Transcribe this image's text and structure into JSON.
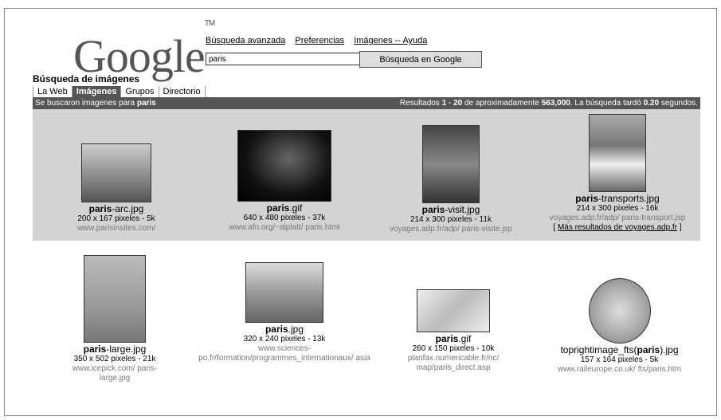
{
  "header": {
    "logo": "Google",
    "trademark": "TM",
    "subtitle": "Búsqueda de imágenes",
    "links": {
      "advanced": "Búsqueda avanzada",
      "prefs": "Preferencias",
      "images_help": "Imágenes -- Ayuda"
    },
    "search_value": "paris",
    "search_button": "Búsqueda en Google"
  },
  "tabs": [
    "La Web",
    "Imágenes",
    "Grupos",
    "Directorio"
  ],
  "results_bar": {
    "left_prefix": "Se buscaron imagenes para ",
    "query": "paris",
    "r_label": "Resultados ",
    "r_from": "1",
    "r_dash": " - ",
    "r_to": "20",
    "r_of": " de aproximadamente ",
    "r_total": "563,000",
    "r_took": ". La búsqueda tardó ",
    "r_time": "0.20",
    "r_sec": " segundos."
  },
  "results": [
    {
      "bold": "paris",
      "rest": "-arc.jpg",
      "size": "200 x 167 pixeles - 5k",
      "url": "www.parisinsites.com/"
    },
    {
      "bold": "paris",
      "rest": ".gif",
      "size": "640 x 480 pixeles - 37k",
      "url": "www.afn.org/~alplatt/ paris.html"
    },
    {
      "bold": "paris",
      "rest": "-visit.jpg",
      "size": "214 x 300 pixeles - 11k",
      "url": "voyages.adp.fr/adp/ paris-visite.jsp"
    },
    {
      "bold": "paris",
      "rest": "-transports.jpg",
      "size": "214 x 300 pixeles - 16k",
      "url": "voyages.adp.fr/adp/ paris-transport.jsp",
      "more": "Más resultados de voyages.adp.fr"
    },
    {
      "bold": "paris",
      "rest": "-large.jpg",
      "size": "350 x 502 pixeles - 21k",
      "url": "www.icepick.com/ paris-large.jpg"
    },
    {
      "bold": "paris",
      "rest": ".jpg",
      "size": "320 x 240 pixeles - 13k",
      "url": "www.sciences-po.fr/formation/programmes_internationaux/ asia"
    },
    {
      "bold": "paris",
      "rest": ".gif",
      "size": "260 x 150 pixeles - 10k",
      "url": "planfax.numericable.fr/nc/ map/paris_direct.asp"
    },
    {
      "pre": "toprightimage_fts(",
      "bold": "paris",
      "rest": ").jpg",
      "size": "157 x 164 pixeles - 5k",
      "url": "www.raileurope.co.uk/ fts/paris.htm"
    }
  ]
}
